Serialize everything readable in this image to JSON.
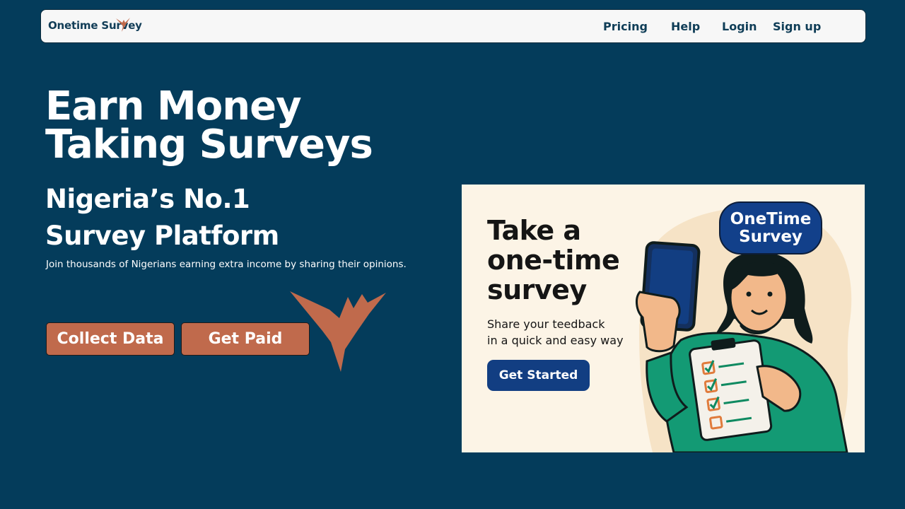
{
  "nav": {
    "brand": "Onetime Survey",
    "links": [
      "Pricing",
      "Help",
      "Login",
      "Sign up"
    ]
  },
  "hero": {
    "headline_line1": "Earn Money",
    "headline_line2": "Taking Surveys",
    "subhead_line1": "Nigeria’s No.1",
    "subhead_line2": "Survey Platform",
    "tagline": "Join thousands of Nigerians earning extra income by sharing their opinions.",
    "buttons": [
      "Collect Data",
      "Get Paid"
    ]
  },
  "promo": {
    "title_line1": "Take a",
    "title_line2": "one-time",
    "title_line3": "survey",
    "desc_line1": "Share your teedback",
    "desc_line2": "in a quick and easy way",
    "button": "Get Started",
    "badge_line1": "OneTime",
    "badge_line2": "Survey"
  },
  "colors": {
    "background": "#043c5b",
    "accent": "#c06a4c",
    "navy_button": "#123e82",
    "card_background": "#fcf4e6",
    "shirt_green": "#139a74"
  },
  "icons": [
    "bird-logo-icon",
    "checkbox-icon"
  ]
}
